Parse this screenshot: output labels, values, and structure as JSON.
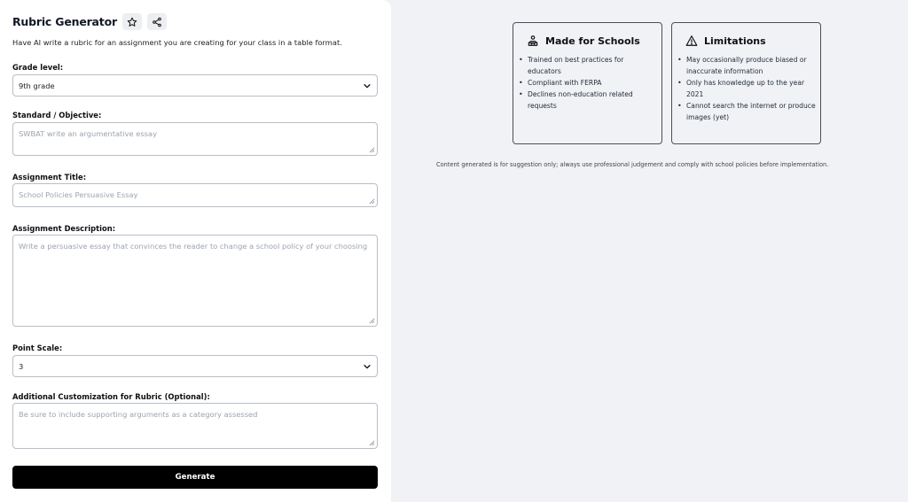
{
  "header": {
    "title": "Rubric Generator",
    "star_icon": "star-icon",
    "share_icon": "share-icon",
    "subtitle": "Have AI write a rubric for an assignment you are creating for your class in a table format."
  },
  "form": {
    "grade_level": {
      "label": "Grade level:",
      "value": "9th grade"
    },
    "standard": {
      "label": "Standard / Objective:",
      "placeholder": "SWBAT write an argumentative essay"
    },
    "assignment_title": {
      "label": "Assignment Title:",
      "placeholder": "School Policies Persuasive Essay"
    },
    "assignment_description": {
      "label": "Assignment Description:",
      "placeholder": "Write a persuasive essay that convinces the reader to change a school policy of your choosing"
    },
    "point_scale": {
      "label": "Point Scale:",
      "value": "3"
    },
    "additional": {
      "label": "Additional Customization for Rubric (Optional):",
      "placeholder": "Be sure to include supporting arguments as a category assessed"
    },
    "generate_label": "Generate"
  },
  "info": {
    "made_for_schools": {
      "title": "Made for Schools",
      "icon": "school-icon",
      "items": [
        "Trained on best practices for educators",
        "Compliant with FERPA",
        "Declines non-education related requests"
      ]
    },
    "limitations": {
      "title": "Limitations",
      "icon": "warning-icon",
      "items": [
        "May occasionally produce biased or inaccurate information",
        "Only has knowledge up to the year 2021",
        "Cannot search the internet or produce images (yet)"
      ]
    },
    "disclaimer": "Content generated is for suggestion only; always use professional judgement and comply with school policies before implementation."
  },
  "colors": {
    "button_bg": "#000000",
    "right_panel_bg": "#f1f2f5",
    "border": "#b8bec8"
  }
}
